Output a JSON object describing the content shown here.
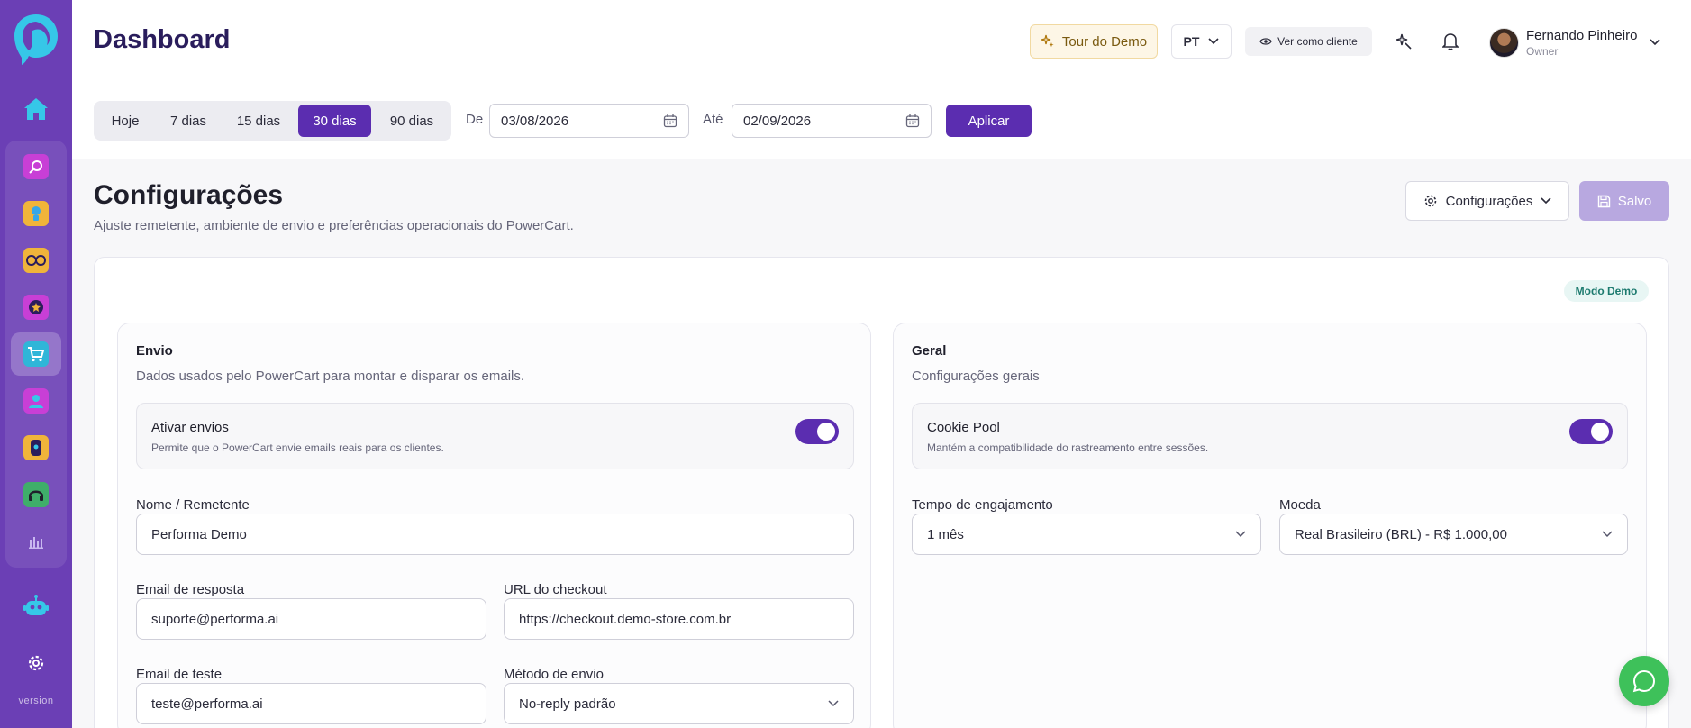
{
  "sidebar": {
    "version_label": "version",
    "apps": [
      {
        "name": "search-app",
        "color": "#c83fd6"
      },
      {
        "name": "lightbulb-app",
        "color": "#f0b43a"
      },
      {
        "name": "infinity-app",
        "color": "#f0b43a"
      },
      {
        "name": "star-app",
        "color": "#c83fd6"
      },
      {
        "name": "cart-app",
        "color": "#2fb6d8",
        "active": true
      },
      {
        "name": "person-app",
        "color": "#c83fd6"
      },
      {
        "name": "lock-app",
        "color": "#f0b43a"
      },
      {
        "name": "headset-app",
        "color": "#3fae6a"
      },
      {
        "name": "chart-app",
        "color": "#8a64d6"
      }
    ]
  },
  "header": {
    "title": "Dashboard",
    "tour_label": "Tour do Demo",
    "lang_label": "PT",
    "client_view_label": "Ver como cliente",
    "user": {
      "name": "Fernando Pinheiro",
      "role": "Owner"
    }
  },
  "range": {
    "options": [
      "Hoje",
      "7 dias",
      "15 dias",
      "30 dias",
      "90 dias"
    ],
    "active": "30 dias",
    "from_label": "De",
    "from_value": "03/08/2026",
    "to_label": "Até",
    "to_value": "02/09/2026",
    "apply_label": "Aplicar"
  },
  "page": {
    "title": "Configurações",
    "subtitle": "Ajuste remetente, ambiente de envio e preferências operacionais do PowerCart.",
    "config_menu_label": "Configurações",
    "saved_label": "Salvo",
    "demo_badge": "Modo Demo"
  },
  "envio": {
    "title": "Envio",
    "subtitle": "Dados usados pelo PowerCart para montar e disparar os emails.",
    "toggle_title": "Ativar envios",
    "toggle_desc": "Permite que o PowerCart envie emails reais para os clientes.",
    "toggle_on": true,
    "sender_label": "Nome / Remetente",
    "sender_value": "Performa Demo",
    "reply_label": "Email de resposta",
    "reply_value": "suporte@performa.ai",
    "checkout_label": "URL do checkout",
    "checkout_value": "https://checkout.demo-store.com.br",
    "test_label": "Email de teste",
    "test_value": "teste@performa.ai",
    "method_label": "Método de envio",
    "method_value": "No-reply padrão"
  },
  "geral": {
    "title": "Geral",
    "subtitle": "Configurações gerais",
    "toggle_title": "Cookie Pool",
    "toggle_desc": "Mantém a compatibilidade do rastreamento entre sessões.",
    "toggle_on": true,
    "engagement_label": "Tempo de engajamento",
    "engagement_value": "1 mês",
    "currency_label": "Moeda",
    "currency_value": "Real Brasileiro (BRL) - R$ 1.000,00"
  },
  "colors": {
    "brand": "#5b2db0",
    "sidebar": "#6b3fb5",
    "whatsapp": "#3ec15a"
  }
}
